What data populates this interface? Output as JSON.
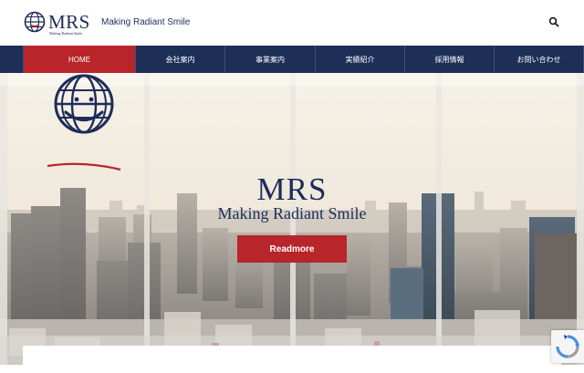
{
  "header": {
    "logo_text": "MRS",
    "logo_subtext": "Making Radiant Smile",
    "tagline": "Making Radiant Smile",
    "search_icon": "search-icon"
  },
  "nav": {
    "items": [
      {
        "label": "HOME",
        "active": true
      },
      {
        "label": "会社案内",
        "active": false
      },
      {
        "label": "事業案内",
        "active": false
      },
      {
        "label": "実績紹介",
        "active": false
      },
      {
        "label": "採用情報",
        "active": false
      },
      {
        "label": "お問い合わせ",
        "active": false
      }
    ]
  },
  "hero": {
    "title": "MRS",
    "subtitle": "Making Radiant Smile",
    "button_label": "Readmore"
  },
  "colors": {
    "navy": "#1d2f57",
    "red": "#b8252b",
    "white": "#ffffff"
  },
  "icons": {
    "logo": "globe-smile-icon",
    "search": "search-icon",
    "recaptcha": "recaptcha-icon"
  }
}
